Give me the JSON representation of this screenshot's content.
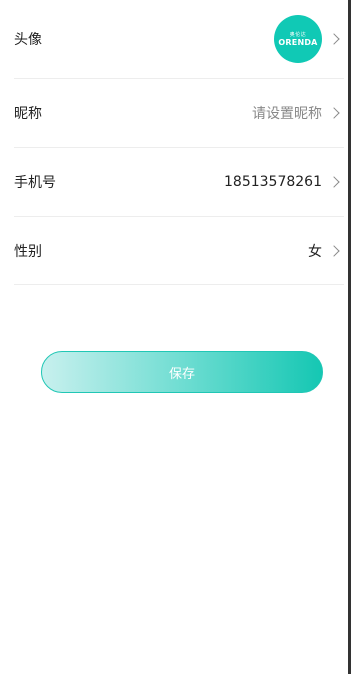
{
  "profile": {
    "avatar": {
      "label": "头像",
      "logo_cn": "奥伦达",
      "logo_brand": "ORENDA"
    },
    "nickname": {
      "label": "昵称",
      "placeholder": "请设置昵称"
    },
    "phone": {
      "label": "手机号",
      "value": "18513578261"
    },
    "gender": {
      "label": "性别",
      "value": "女"
    }
  },
  "actions": {
    "save_label": "保存"
  },
  "colors": {
    "accent": "#10c9b5",
    "divider": "#ededed"
  }
}
